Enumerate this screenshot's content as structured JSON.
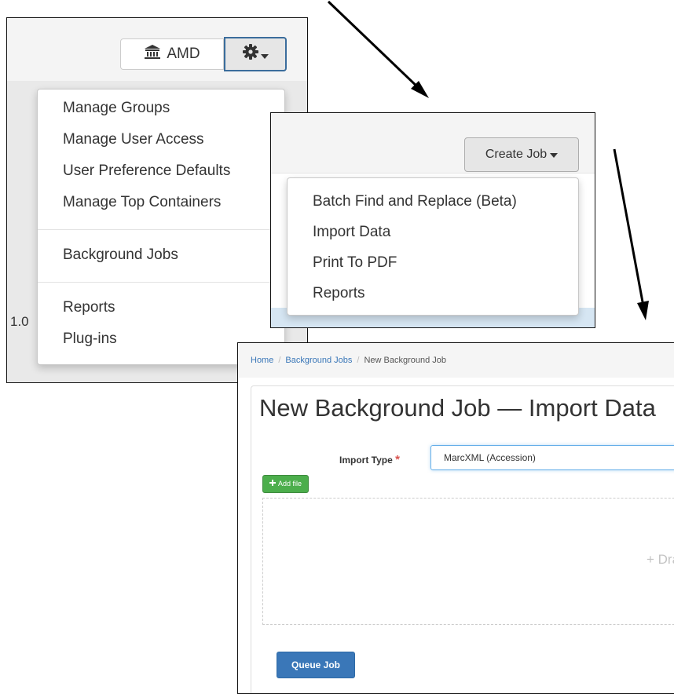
{
  "panel1": {
    "repo_button_label": "AMD",
    "repo_icon": "bank-icon",
    "gear_icon": "gear-icon",
    "side_text": "1.0",
    "menu_group1": [
      "Manage Groups",
      "Manage User Access",
      "User Preference Defaults",
      "Manage Top Containers"
    ],
    "menu_group2": [
      "Background Jobs"
    ],
    "menu_group3": [
      "Reports",
      "Plug-ins"
    ]
  },
  "panel2": {
    "create_job_label": "Create Job",
    "menu_items": [
      "Batch Find and Replace (Beta)",
      "Import Data",
      "Print To PDF",
      "Reports"
    ]
  },
  "panel3": {
    "breadcrumb": {
      "home": "Home",
      "jobs": "Background Jobs",
      "current": "New Background Job",
      "divider": "/"
    },
    "title": "New Background Job — Import Data",
    "import_type_label": "Import Type",
    "required_mark": "*",
    "import_type_value": "MarcXML (Accession)",
    "add_file_label": "Add file",
    "drop_text": "+ Drag a",
    "queue_button_label": "Queue Job"
  },
  "colors": {
    "link": "#3a77b8",
    "success": "#4cae4c",
    "primary": "#3a77b8",
    "required": "#d9534f"
  }
}
